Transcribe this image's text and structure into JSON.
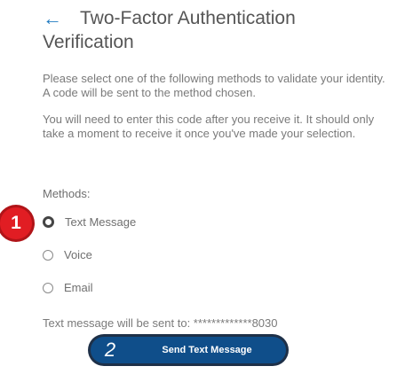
{
  "header": {
    "back_icon": "←",
    "title_line1": "Two-Factor Authentication",
    "title_line2": "Verification"
  },
  "instructions": {
    "p1": "Please select one of the following methods to validate your identity. A code will be sent to the method chosen.",
    "p2": "You will need to enter this code after you receive it. It should only take a moment to receive it once you've made your selection."
  },
  "methods": {
    "label": "Methods:",
    "options": [
      {
        "label": "Text Message",
        "selected": true
      },
      {
        "label": "Voice",
        "selected": false
      },
      {
        "label": "Email",
        "selected": false
      }
    ]
  },
  "sent_to": "Text message will be sent to: *************8030",
  "send_button": {
    "label": "Send Text Message"
  },
  "annotations": {
    "step1": "1",
    "step2": "2"
  },
  "colors": {
    "accent": "#0f4e8a",
    "back_arrow": "#1f7ac0",
    "badge": "#e11d23"
  }
}
